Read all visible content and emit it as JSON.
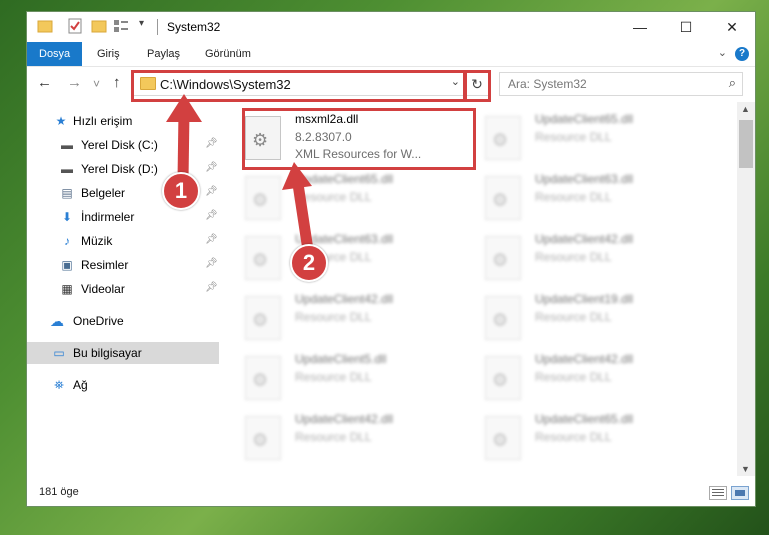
{
  "window": {
    "title": "System32"
  },
  "window_controls": {
    "minimize": "—",
    "maximize": "☐",
    "close": "✕"
  },
  "ribbon": {
    "tabs": [
      "Dosya",
      "Giriş",
      "Paylaş",
      "Görünüm"
    ],
    "help": "?",
    "expand": "⌄"
  },
  "nav": {
    "back": "←",
    "forward": "→",
    "recent": "˅",
    "up": "↑",
    "address": "C:\\Windows\\System32",
    "address_dropdown": "⌄",
    "refresh": "↻",
    "search_placeholder": "Ara: System32",
    "search_icon": "⌕"
  },
  "sidebar": {
    "items": [
      {
        "label": "Hızlı erişim",
        "icon": "★",
        "icon_color": "#2a7fd4"
      },
      {
        "label": "Yerel Disk (C:)",
        "icon": "▬",
        "icon_color": "#555555",
        "pinned": "📌"
      },
      {
        "label": "Yerel Disk (D:)",
        "icon": "▬",
        "icon_color": "#555555",
        "pinned": "📌"
      },
      {
        "label": "Belgeler",
        "icon": "▤",
        "icon_color": "#5a6f8a",
        "pinned": "📌"
      },
      {
        "label": "İndirmeler",
        "icon": "⬇",
        "icon_color": "#2a7fd4",
        "pinned": "📌"
      },
      {
        "label": "Müzik",
        "icon": "♪",
        "icon_color": "#2a7fd4",
        "pinned": "📌"
      },
      {
        "label": "Resimler",
        "icon": "▣",
        "icon_color": "#4a6d92",
        "pinned": "📌"
      },
      {
        "label": "Videolar",
        "icon": "▦",
        "icon_color": "#333333",
        "pinned": "📌"
      },
      {
        "label": "OneDrive",
        "icon": "☁",
        "icon_color": "#2a7fd4"
      },
      {
        "label": "Bu bilgisayar",
        "icon": "▭",
        "icon_color": "#2a7fd4"
      },
      {
        "label": "Ağ",
        "icon": "⛯",
        "icon_color": "#2a7fd4"
      }
    ]
  },
  "files": [
    {
      "name": "msxml2a.dll",
      "line2": "8.2.8307.0",
      "line3": "XML Resources for W..."
    },
    {
      "name": "UpdateClient65.dll",
      "line2": "Resource DLL"
    },
    {
      "name": "UpdateClient65.dll",
      "line2": "Resource DLL"
    },
    {
      "name": "UpdateClient63.dll",
      "line2": "Resource DLL"
    },
    {
      "name": "UpdateClient63.dll",
      "line2": "Resource DLL"
    },
    {
      "name": "UpdateClient42.dll",
      "line2": "Resource DLL"
    },
    {
      "name": "UpdateClient42.dll",
      "line2": "Resource DLL"
    },
    {
      "name": "UpdateClient19.dll",
      "line2": "Resource DLL"
    },
    {
      "name": "UpdateClient5.dll",
      "line2": "Resource DLL"
    },
    {
      "name": "UpdateClient42.dll",
      "line2": "Resource DLL"
    },
    {
      "name": "UpdateClient42.dll",
      "line2": "Resource DLL"
    },
    {
      "name": "UpdateClient65.dll",
      "line2": "Resource DLL"
    }
  ],
  "status": {
    "count": "181 öge"
  },
  "annotations": {
    "step1": "1",
    "step2": "2",
    "color": "#d24040"
  }
}
